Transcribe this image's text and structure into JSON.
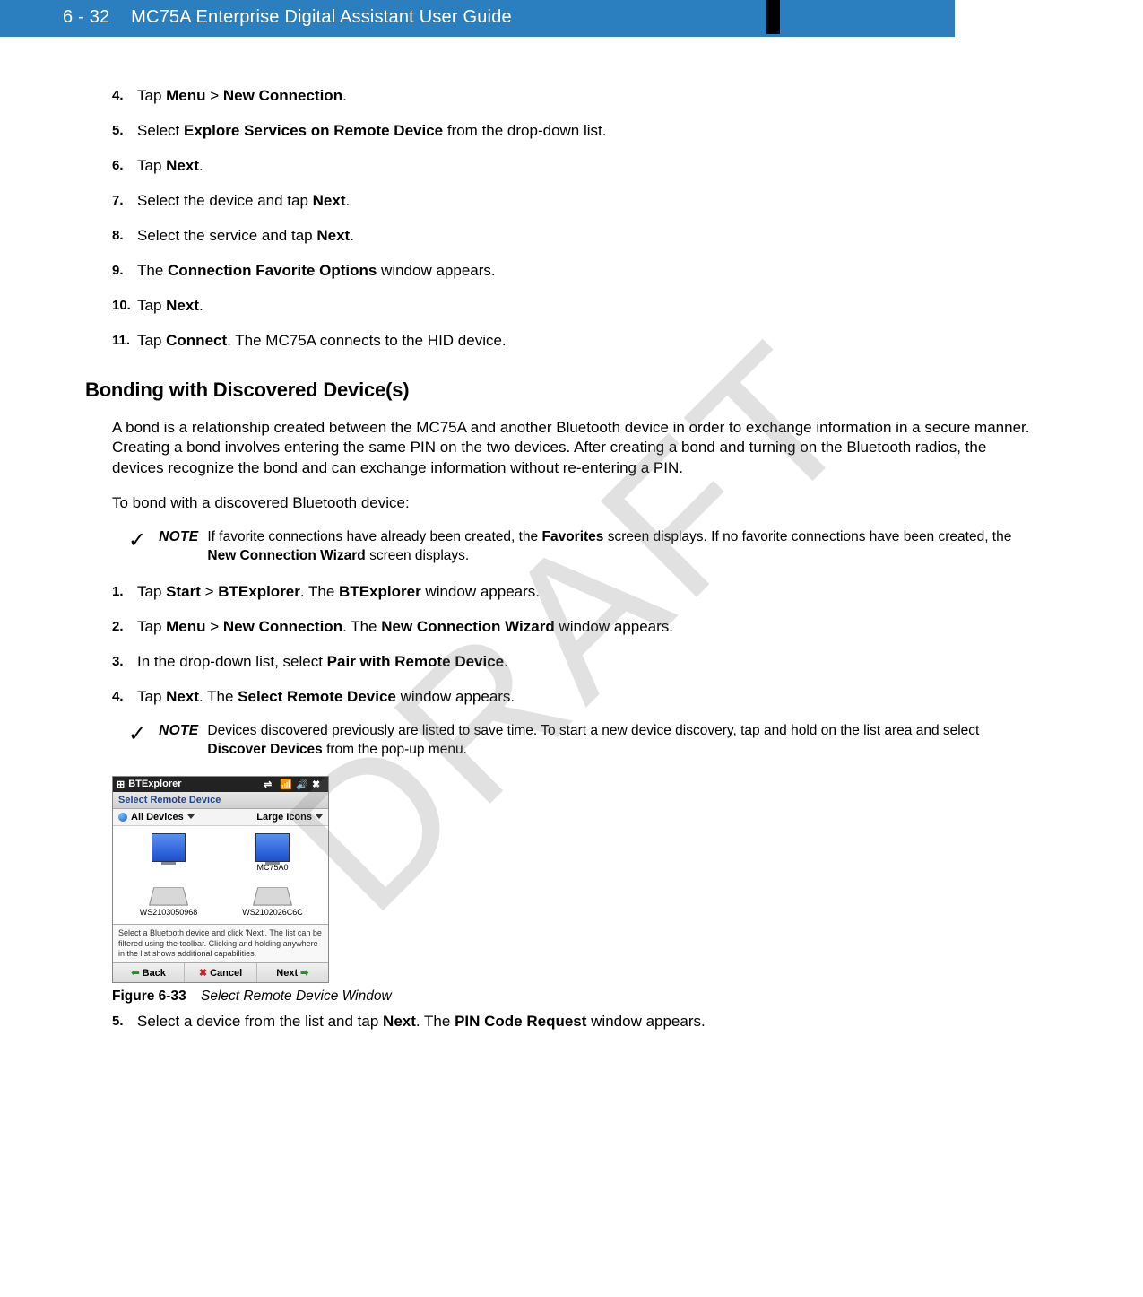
{
  "header": {
    "page_number": "6 - 32",
    "title": "MC75A Enterprise Digital Assistant User Guide"
  },
  "watermark": "DRAFT",
  "list1": [
    {
      "n": "4.",
      "parts": [
        "Tap ",
        {
          "b": "Menu"
        },
        " > ",
        {
          "b": "New Connection"
        },
        "."
      ]
    },
    {
      "n": "5.",
      "parts": [
        "Select ",
        {
          "b": "Explore Services on Remote Device"
        },
        " from the drop-down list."
      ]
    },
    {
      "n": "6.",
      "parts": [
        "Tap ",
        {
          "b": "Next"
        },
        "."
      ]
    },
    {
      "n": "7.",
      "parts": [
        "Select the device and tap ",
        {
          "b": "Next"
        },
        "."
      ]
    },
    {
      "n": "8.",
      "parts": [
        "Select the service and tap ",
        {
          "b": "Next"
        },
        "."
      ]
    },
    {
      "n": "9.",
      "parts": [
        "The ",
        {
          "b": "Connection Favorite Options"
        },
        " window appears."
      ]
    },
    {
      "n": "10.",
      "parts": [
        "Tap ",
        {
          "b": "Next"
        },
        "."
      ]
    },
    {
      "n": "11.",
      "parts": [
        "Tap ",
        {
          "b": "Connect"
        },
        ". The MC75A connects to the HID device."
      ]
    }
  ],
  "section_heading": "Bonding with Discovered Device(s)",
  "paragraph1": "A bond is a relationship created between the MC75A and another Bluetooth device in order to exchange information in a secure manner. Creating a bond involves entering the same PIN on the two devices. After creating a bond and turning on the Bluetooth radios, the devices recognize the bond and can exchange information without re-entering a PIN.",
  "paragraph2": "To bond with a discovered Bluetooth device:",
  "note1": {
    "label": "NOTE",
    "parts": [
      "If favorite connections have already been created, the ",
      {
        "b": "Favorites"
      },
      " screen displays. If no favorite connections have been created, the ",
      {
        "b": "New Connection Wizard"
      },
      " screen displays."
    ]
  },
  "list2": [
    {
      "n": "1.",
      "parts": [
        "Tap ",
        {
          "b": "Start"
        },
        " > ",
        {
          "b": "BTExplorer"
        },
        ". The ",
        {
          "b": "BTExplorer"
        },
        " window appears."
      ]
    },
    {
      "n": "2.",
      "parts": [
        "Tap ",
        {
          "b": "Menu"
        },
        " > ",
        {
          "b": "New Connection"
        },
        ". The ",
        {
          "b": "New Connection Wizard"
        },
        " window appears."
      ]
    },
    {
      "n": "3.",
      "parts": [
        "In the drop-down list, select ",
        {
          "b": "Pair with Remote Device"
        },
        "."
      ]
    },
    {
      "n": "4.",
      "parts": [
        "Tap ",
        {
          "b": "Next"
        },
        ". The ",
        {
          "b": "Select Remote Device"
        },
        " window appears."
      ]
    }
  ],
  "note2": {
    "label": "NOTE",
    "parts": [
      "Devices discovered previously are listed to save time. To start a new device discovery, tap and hold on the list area and select ",
      {
        "b": "Discover Devices"
      },
      " from the pop-up menu."
    ]
  },
  "bt_window": {
    "title": "BTExplorer",
    "subheader": "Select Remote Device",
    "toolbar_left": "All Devices",
    "toolbar_right": "Large Icons",
    "devices": [
      {
        "label": "",
        "type": "pc",
        "selected": true
      },
      {
        "label": "MC75A0",
        "type": "pc",
        "selected": false
      },
      {
        "label": "WS2103050968",
        "type": "laptop",
        "selected": false
      },
      {
        "label": "WS2102026C6C",
        "type": "laptop",
        "selected": false
      }
    ],
    "info_text": "Select a Bluetooth device and click 'Next'. The list can be filtered using the toolbar. Clicking and holding anywhere in the list shows additional capabilities.",
    "buttons": {
      "back": "Back",
      "cancel": "Cancel",
      "next": "Next"
    }
  },
  "figure": {
    "label": "Figure 6-33",
    "title": "Select Remote Device Window"
  },
  "list3": [
    {
      "n": "5.",
      "parts": [
        "Select a device from the list and tap ",
        {
          "b": "Next"
        },
        ". The ",
        {
          "b": "PIN Code Request"
        },
        " window appears."
      ]
    }
  ]
}
